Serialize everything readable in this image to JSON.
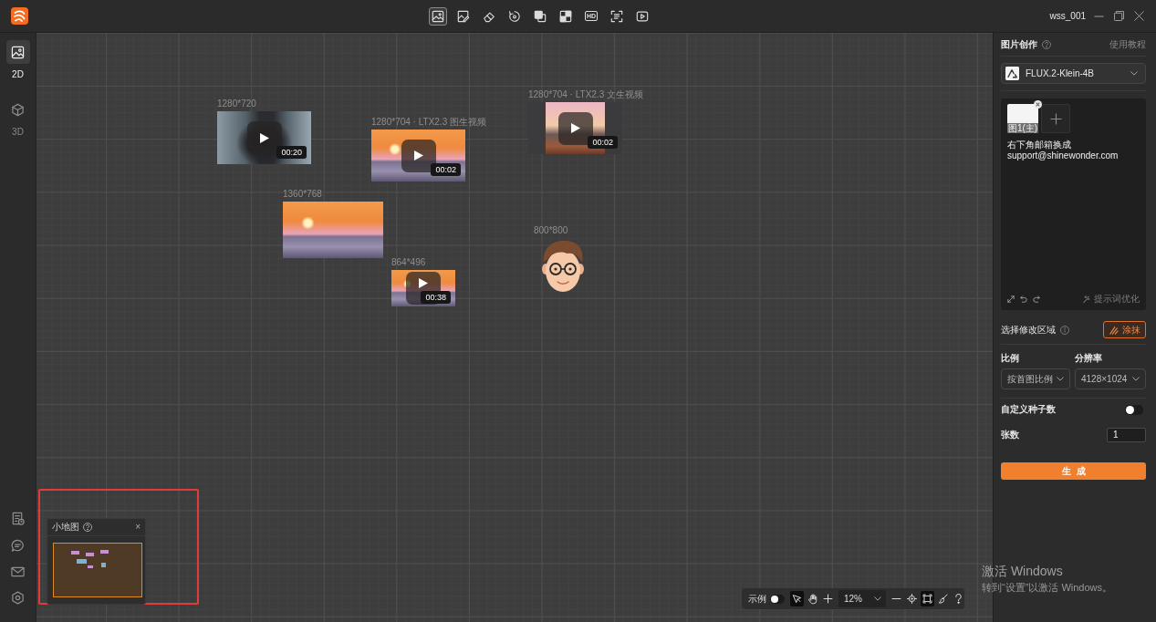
{
  "top_toolbar": {
    "tools": [
      {
        "kind": "image",
        "selected": true
      },
      {
        "kind": "pen",
        "selected": false
      },
      {
        "kind": "eraser",
        "selected": false
      },
      {
        "kind": "rotate",
        "selected": false
      },
      {
        "kind": "layers",
        "selected": false
      },
      {
        "kind": "corner",
        "selected": false
      },
      {
        "kind": "text",
        "label": "HD",
        "selected": false
      },
      {
        "kind": "scan",
        "selected": false
      },
      {
        "kind": "video",
        "selected": false
      }
    ]
  },
  "window": {
    "user": "wss_001"
  },
  "sidebar": {
    "modes": [
      {
        "kind": "image",
        "label": "2D",
        "selected": true
      },
      {
        "kind": "cube",
        "label": "3D",
        "selected": false
      }
    ]
  },
  "canvas": {
    "items": [
      {
        "kind": "video",
        "caption": "1280*720",
        "duration": "00:20"
      },
      {
        "kind": "video",
        "caption": "1280*704 · LTX2.3 图生视频",
        "duration": "00:02"
      },
      {
        "kind": "video",
        "caption": "1280*704 · LTX2.3 文生视频",
        "duration": "00:02"
      },
      {
        "kind": "image",
        "caption": "1360*768"
      },
      {
        "kind": "video",
        "caption": "864*496",
        "duration": "00:38"
      },
      {
        "kind": "avatar",
        "caption": "800*800"
      }
    ]
  },
  "minimap": {
    "title": "小地图",
    "close": "×"
  },
  "bottom_toolbar": {
    "example_label": "示例",
    "example_on": false,
    "tools": [
      {
        "kind": "pointer",
        "selected": true
      },
      {
        "kind": "hand",
        "selected": false
      },
      {
        "kind": "plus",
        "selected": false
      }
    ],
    "zoom": "12%",
    "view_tools": [
      {
        "kind": "minus",
        "selected": false
      },
      {
        "kind": "locate",
        "selected": false
      },
      {
        "kind": "fit",
        "selected": true
      },
      {
        "kind": "brush",
        "selected": false
      },
      {
        "kind": "help",
        "selected": false
      }
    ]
  },
  "panel": {
    "title": "图片创作",
    "tutorial_link": "使用教程",
    "model": "FLUX.2-Klein-4B",
    "reference_images": [
      {
        "label": "图1(主)"
      }
    ],
    "prompt": "右下角邮箱换成\nsupport@shinewonder.com",
    "optimize_label": "提示词优化",
    "region_label": "选择修改区域",
    "paint_button": "涂抹",
    "ratio_label": "比例",
    "ratio_value": "按首图比例",
    "resolution_label": "分辨率",
    "resolution_value": "4128×1024",
    "custom_seed_label": "自定义种子数",
    "custom_seed_on": false,
    "count_label": "张数",
    "count_value": "1",
    "generate_button": "生成"
  },
  "os_notice": {
    "title": "激活 Windows",
    "text": "转到“设置”以激活 Windows。"
  }
}
